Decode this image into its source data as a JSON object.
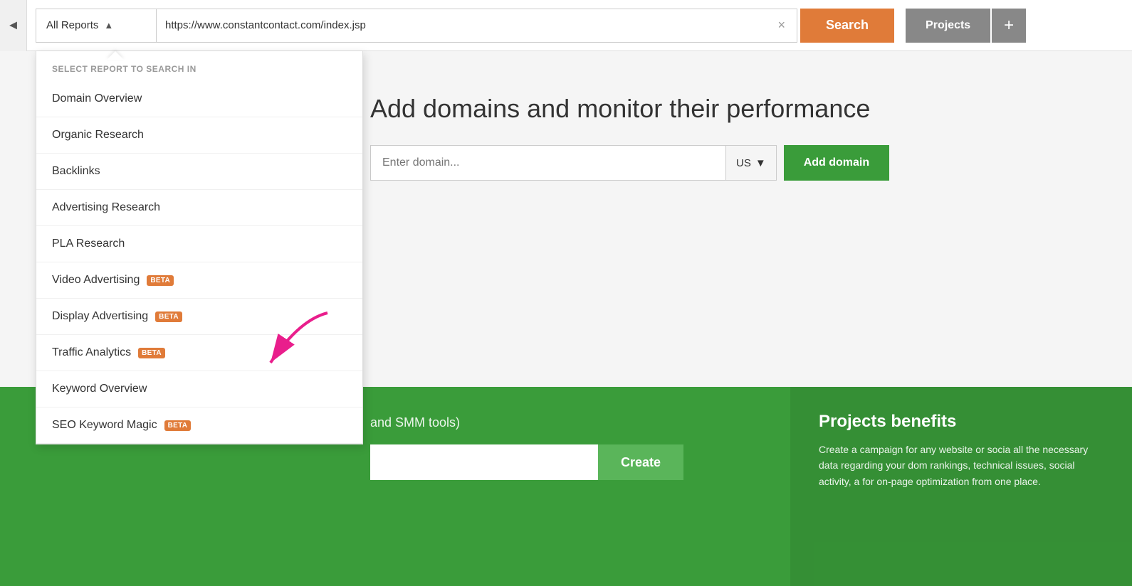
{
  "topbar": {
    "back_label": "◄",
    "report_selector_label": "All Reports",
    "report_selector_chevron": "▲",
    "url_value": "https://www.constantcontact.com/index.jsp",
    "clear_label": "×",
    "search_label": "Search",
    "projects_label": "Projects",
    "plus_label": "+"
  },
  "dropdown": {
    "header": "SELECT REPORT TO SEARCH IN",
    "items": [
      {
        "label": "Domain Overview",
        "beta": false
      },
      {
        "label": "Organic Research",
        "beta": false
      },
      {
        "label": "Backlinks",
        "beta": false
      },
      {
        "label": "Advertising Research",
        "beta": false
      },
      {
        "label": "PLA Research",
        "beta": false
      },
      {
        "label": "Video Advertising",
        "beta": true
      },
      {
        "label": "Display Advertising",
        "beta": true
      },
      {
        "label": "Traffic Analytics",
        "beta": true
      },
      {
        "label": "Keyword Overview",
        "beta": false
      },
      {
        "label": "SEO Keyword Magic",
        "beta": true
      }
    ],
    "beta_label": "BETA"
  },
  "main": {
    "heading": "Add domains and monitor their performance",
    "domain_placeholder": "Enter domain...",
    "country_label": "US",
    "chevron": "▼",
    "add_domain_label": "Add domain"
  },
  "green_section": {
    "left_text": "and SMM tools)",
    "create_input_placeholder": "",
    "create_label": "Create",
    "right_title": "Projects benefits",
    "right_text": "Create a campaign for any website or socia all the necessary data regarding your dom rankings, technical issues, social activity, a for on-page optimization from one place."
  }
}
